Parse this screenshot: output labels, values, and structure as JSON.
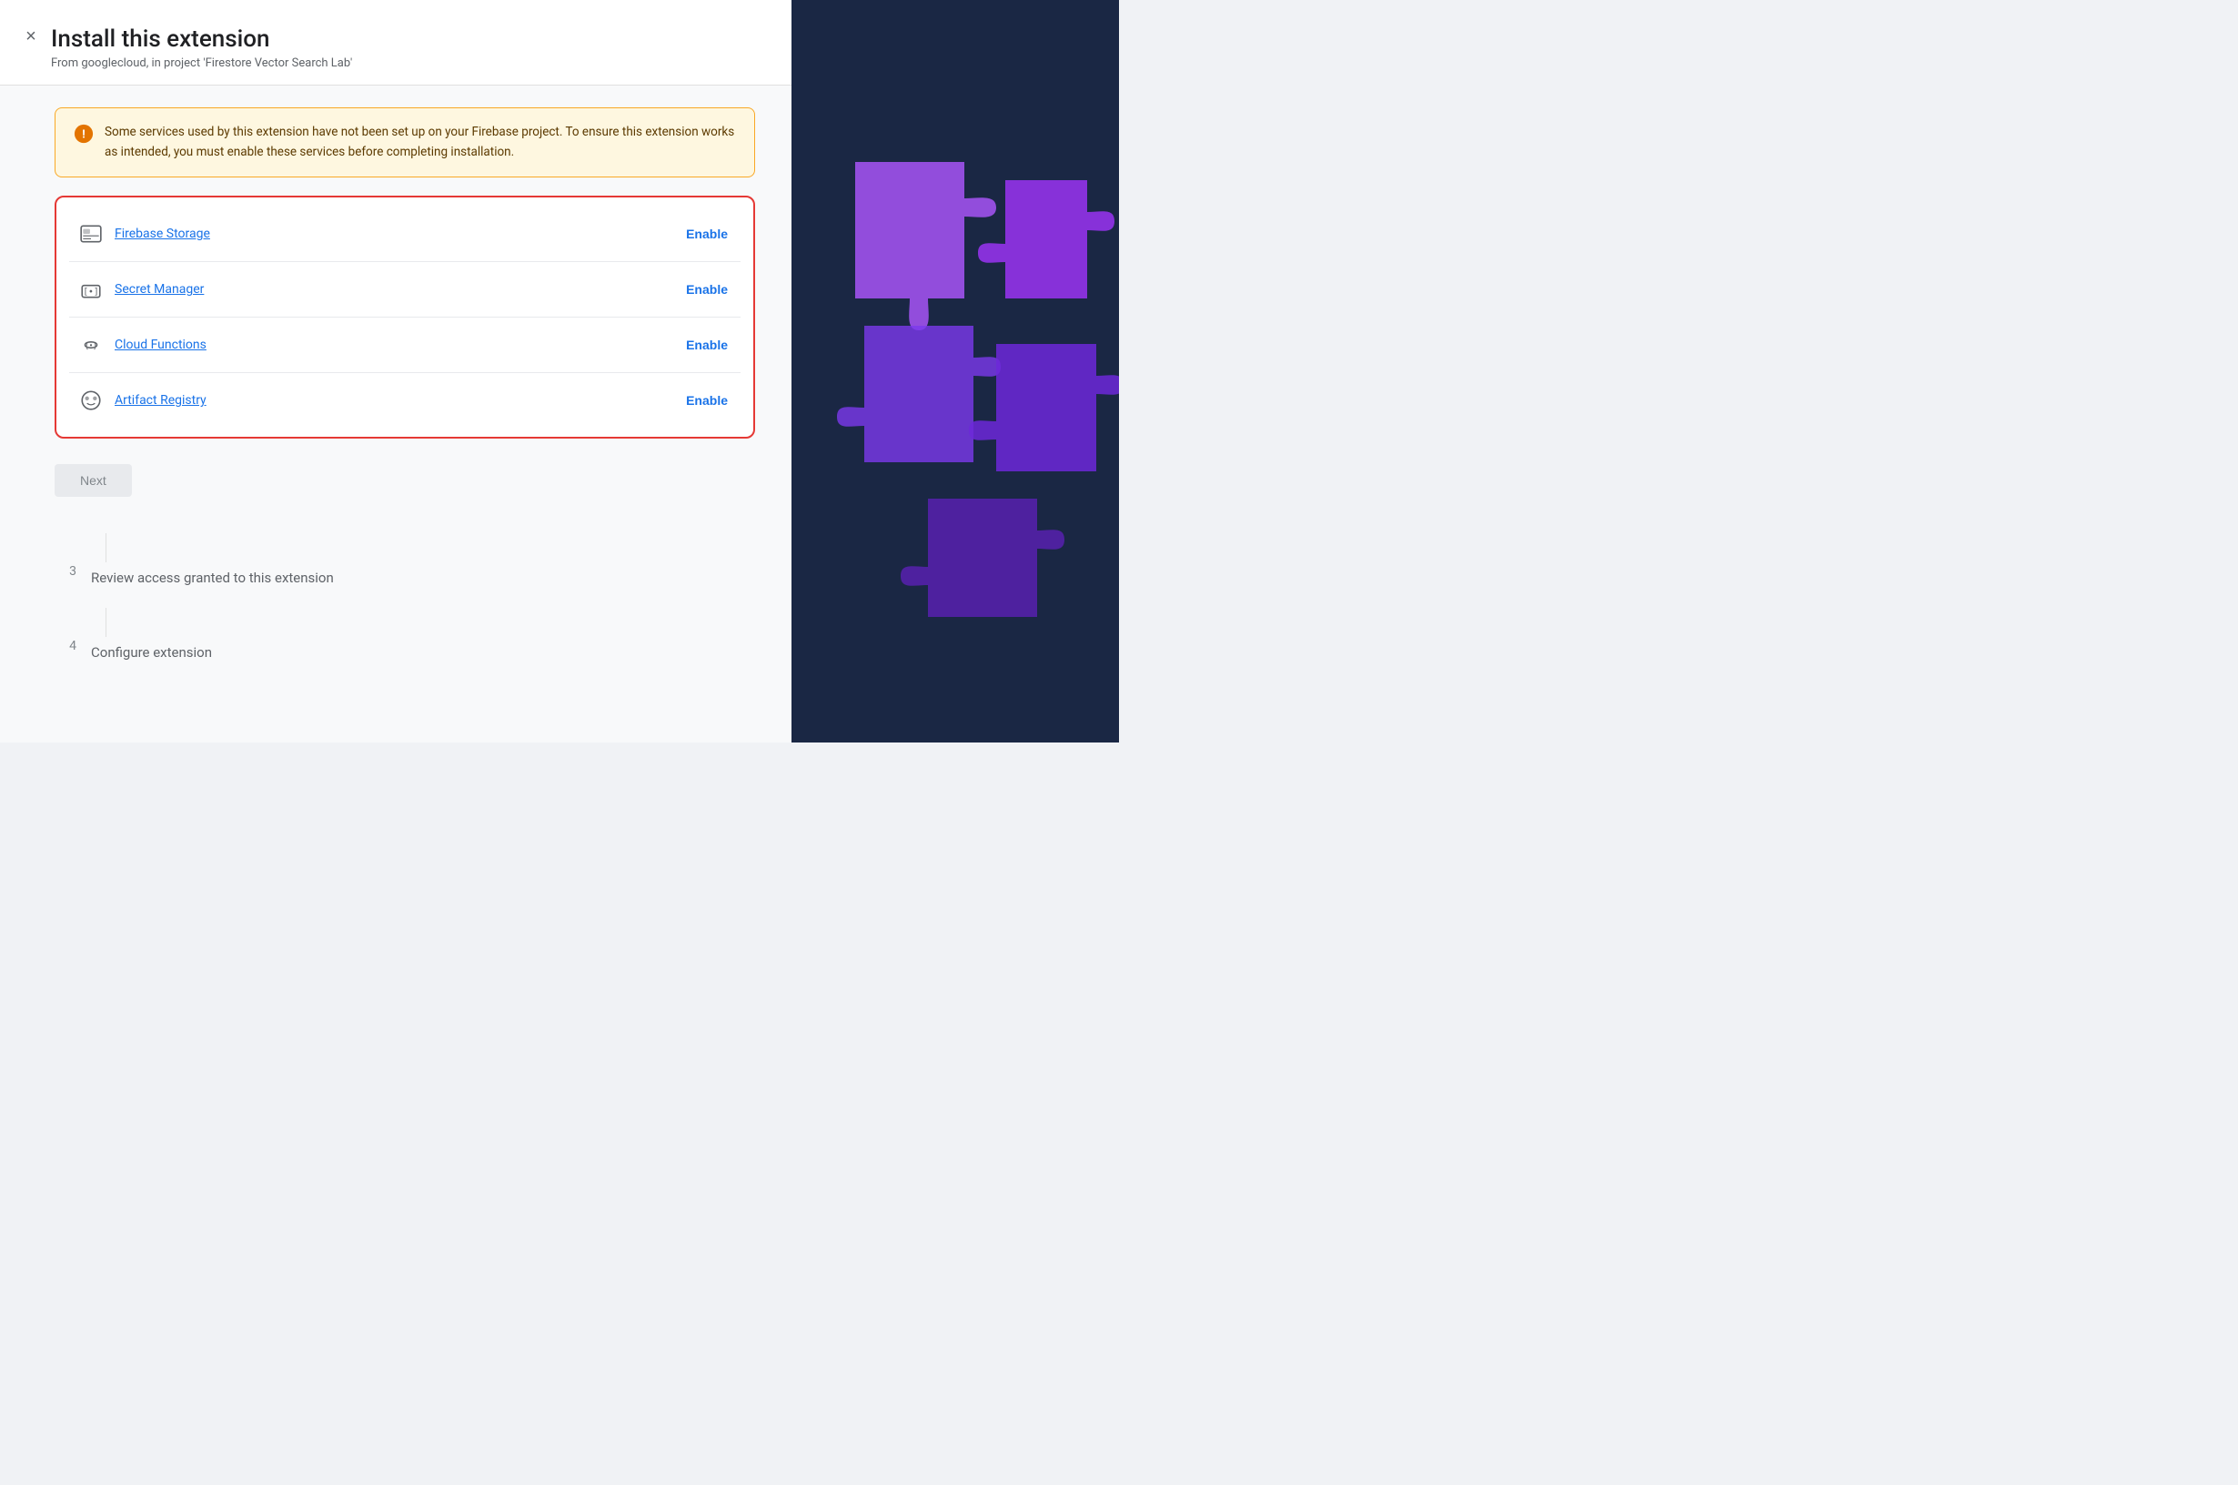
{
  "header": {
    "title": "Install this extension",
    "subtitle": "From googlecloud, in project 'Firestore Vector Search Lab'",
    "close_label": "×"
  },
  "warning": {
    "text": "Some services used by this extension have not been set up on your Firebase project. To ensure this extension works as intended, you must enable these services before completing installation."
  },
  "services": [
    {
      "name": "Firebase Storage",
      "icon": "storage",
      "enable_label": "Enable"
    },
    {
      "name": "Secret Manager",
      "icon": "secret",
      "enable_label": "Enable"
    },
    {
      "name": "Cloud Functions",
      "icon": "functions",
      "enable_label": "Enable"
    },
    {
      "name": "Artifact Registry",
      "icon": "artifact",
      "enable_label": "Enable"
    }
  ],
  "buttons": {
    "next_label": "Next"
  },
  "steps": [
    {
      "number": "3",
      "label": "Review access granted to this extension"
    },
    {
      "number": "4",
      "label": "Configure extension"
    }
  ]
}
